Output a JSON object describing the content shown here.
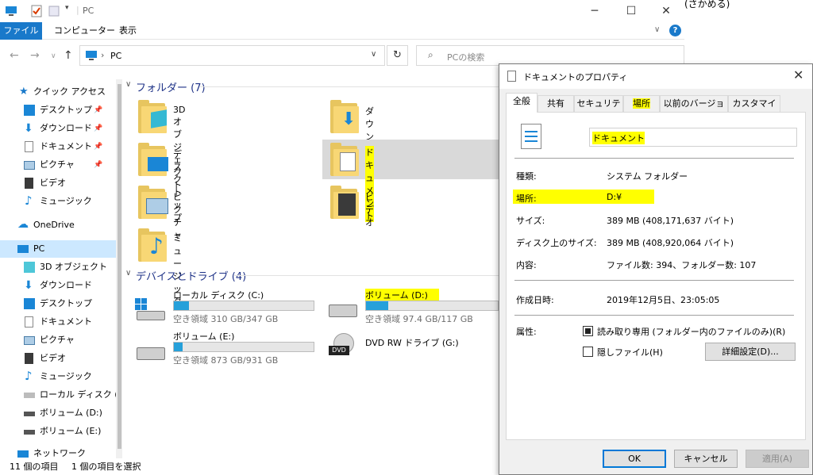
{
  "explorer": {
    "title": "PC",
    "ribbon_tabs": [
      "ファイル",
      "コンピューター",
      "表示"
    ],
    "address": "PC",
    "search_placeholder": "PCの検索",
    "status_items": "11 個の項目",
    "status_selected": "1 個の項目を選択",
    "accent_color": "#1979ca"
  },
  "nav": {
    "quick_access": "クイック アクセス",
    "quick_items": [
      "デスクトップ",
      "ダウンロード",
      "ドキュメント",
      "ピクチャ",
      "ビデオ",
      "ミュージック"
    ],
    "onedrive": "OneDrive",
    "pc": "PC",
    "pc_items": [
      "3D オブジェクト",
      "ダウンロード",
      "デスクトップ",
      "ドキュメント",
      "ピクチャ",
      "ビデオ",
      "ミュージック",
      "ローカル ディスク (C",
      "ボリューム (D:)",
      "ボリューム (E:)"
    ],
    "network": "ネットワーク"
  },
  "folders": {
    "header": "フォルダー (7)",
    "items": [
      "3D オブジェクト",
      "ダウンロード",
      "デスクトップ",
      "ドキュメント",
      "ピクチャ",
      "ビデオ",
      "ミュージック"
    ]
  },
  "drives": {
    "header": "デバイスとドライブ (4)",
    "items": [
      {
        "name": "ローカル ディスク (C:)",
        "free": "空き領域 310 GB/347 GB",
        "used_fraction": 0.107
      },
      {
        "name": "ボリューム (D:)",
        "free": "空き領域 97.4 GB/117 GB",
        "used_fraction": 0.168
      },
      {
        "name": "ボリューム (E:)",
        "free": "空き領域 873 GB/931 GB",
        "used_fraction": 0.062
      },
      {
        "name": "DVD RW ドライブ (G:)"
      }
    ]
  },
  "dialog": {
    "title": "ドキュメントのプロパティ",
    "tabs": [
      "全般",
      "共有",
      "セキュリティ",
      "場所",
      "以前のバージョン",
      "カスタマイズ"
    ],
    "name_value": "ドキュメント",
    "rows": [
      {
        "label": "種類:",
        "value": "システム フォルダー"
      },
      {
        "label": "場所:",
        "value": "D:¥"
      },
      {
        "label": "サイズ:",
        "value": "389 MB (408,171,637 バイト)"
      },
      {
        "label": "ディスク上のサイズ:",
        "value": "389 MB (408,920,064 バイト)"
      },
      {
        "label": "内容:",
        "value": "ファイル数: 394、フォルダー数: 107"
      },
      {
        "label": "作成日時:",
        "value": "2019年12月5日、23:05:05"
      },
      {
        "label": "属性:",
        "value": ""
      }
    ],
    "readonly_label": "読み取り専用 (フォルダー内のファイルのみ)(R)",
    "hidden_label": "隠しファイル(H)",
    "advanced_button": "詳細設定(D)...",
    "ok": "OK",
    "cancel": "キャンセル",
    "apply": "適用(A)"
  },
  "corner_note": "(さかめる)"
}
